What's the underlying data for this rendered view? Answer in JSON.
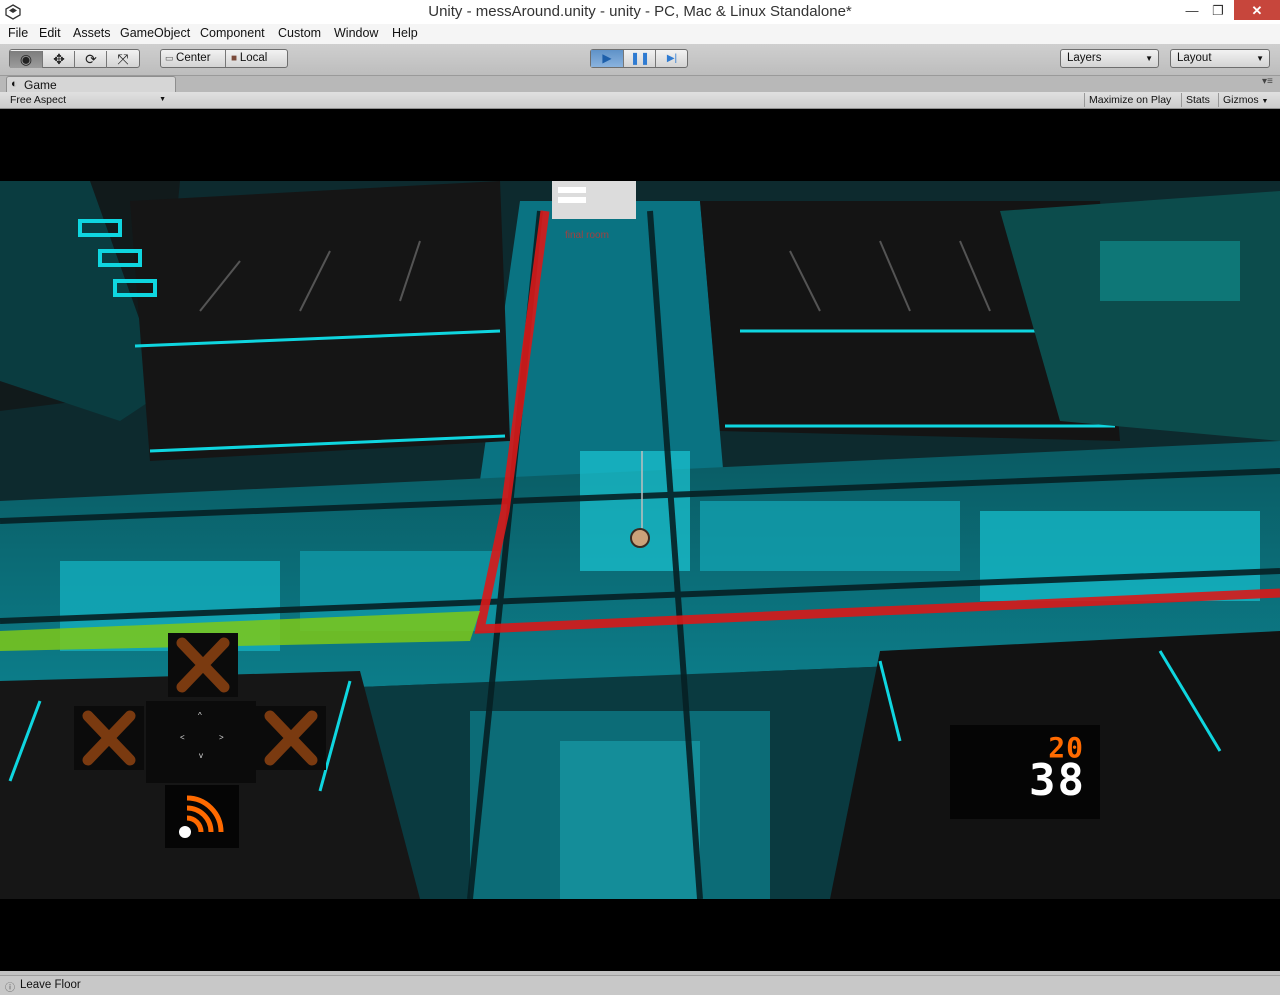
{
  "window": {
    "title": "Unity - messAround.unity - unity - PC, Mac & Linux Standalone*",
    "minimize": "—",
    "maximize": "❐",
    "close": "✕"
  },
  "menu": [
    "File",
    "Edit",
    "Assets",
    "GameObject",
    "Component",
    "Custom",
    "Window",
    "Help"
  ],
  "toolbar": {
    "tools": [
      {
        "icon": "view-tool-icon",
        "glyph": "◉"
      },
      {
        "icon": "move-tool-icon",
        "glyph": "✥"
      },
      {
        "icon": "rotate-tool-icon",
        "glyph": "⟳"
      },
      {
        "icon": "scale-tool-icon",
        "glyph": "⤧"
      }
    ],
    "pivot": "Center",
    "space": "Local",
    "play_glyph": "▶",
    "pause_glyph": "❚❚",
    "step_glyph": "▶|",
    "layers": "Layers",
    "layout": "Layout"
  },
  "panel": {
    "tab": "Game",
    "aspect": "Free Aspect",
    "maximize_on_play": "Maximize on Play",
    "stats": "Stats",
    "gizmos": "Gizmos"
  },
  "game": {
    "floor_label": "final room",
    "score_top": "20",
    "score_bottom": "38",
    "colors": {
      "accent_cyan": "#12b8c8",
      "path_red": "#d81818",
      "hud_orange": "#ff6a00",
      "hud_x": "#7a3a10"
    }
  },
  "status": {
    "text": "Leave Floor"
  }
}
